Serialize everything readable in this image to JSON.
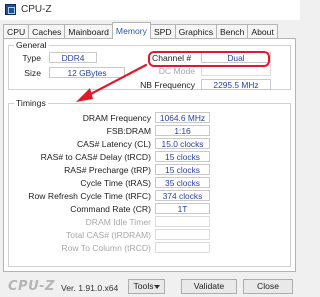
{
  "window": {
    "title": "CPU-Z"
  },
  "tabs": [
    {
      "label": "CPU"
    },
    {
      "label": "Caches"
    },
    {
      "label": "Mainboard"
    },
    {
      "label": "Memory"
    },
    {
      "label": "SPD"
    },
    {
      "label": "Graphics"
    },
    {
      "label": "Bench"
    },
    {
      "label": "About"
    }
  ],
  "active_tab": "Memory",
  "general": {
    "group_label": "General",
    "type_label": "Type",
    "type_value": "DDR4",
    "size_label": "Size",
    "size_value": "12 GBytes",
    "channel_label": "Channel #",
    "channel_value": "Dual",
    "dc_mode_label": "DC Mode",
    "dc_mode_value": "",
    "nb_freq_label": "NB Frequency",
    "nb_freq_value": "2295.5 MHz"
  },
  "timings": {
    "group_label": "Timings",
    "rows": [
      {
        "label": "DRAM Frequency",
        "value": "1064.6 MHz",
        "enabled": true
      },
      {
        "label": "FSB:DRAM",
        "value": "1:16",
        "enabled": true
      },
      {
        "label": "CAS# Latency (CL)",
        "value": "15.0 clocks",
        "enabled": true
      },
      {
        "label": "RAS# to CAS# Delay (tRCD)",
        "value": "15 clocks",
        "enabled": true
      },
      {
        "label": "RAS# Precharge (tRP)",
        "value": "15 clocks",
        "enabled": true
      },
      {
        "label": "Cycle Time (tRAS)",
        "value": "35 clocks",
        "enabled": true
      },
      {
        "label": "Row Refresh Cycle Time (tRFC)",
        "value": "374 clocks",
        "enabled": true
      },
      {
        "label": "Command Rate (CR)",
        "value": "1T",
        "enabled": true
      },
      {
        "label": "DRAM Idle Timer",
        "value": "",
        "enabled": false
      },
      {
        "label": "Total CAS# (tRDRAM)",
        "value": "",
        "enabled": false
      },
      {
        "label": "Row To Column (tRCD)",
        "value": "",
        "enabled": false
      }
    ]
  },
  "footer": {
    "brand": "CPU-Z",
    "version": "Ver. 1.91.0.x64",
    "tools_label": "Tools",
    "validate_label": "Validate",
    "close_label": "Close"
  },
  "annotation": {
    "highlight_color": "#e0192a"
  }
}
